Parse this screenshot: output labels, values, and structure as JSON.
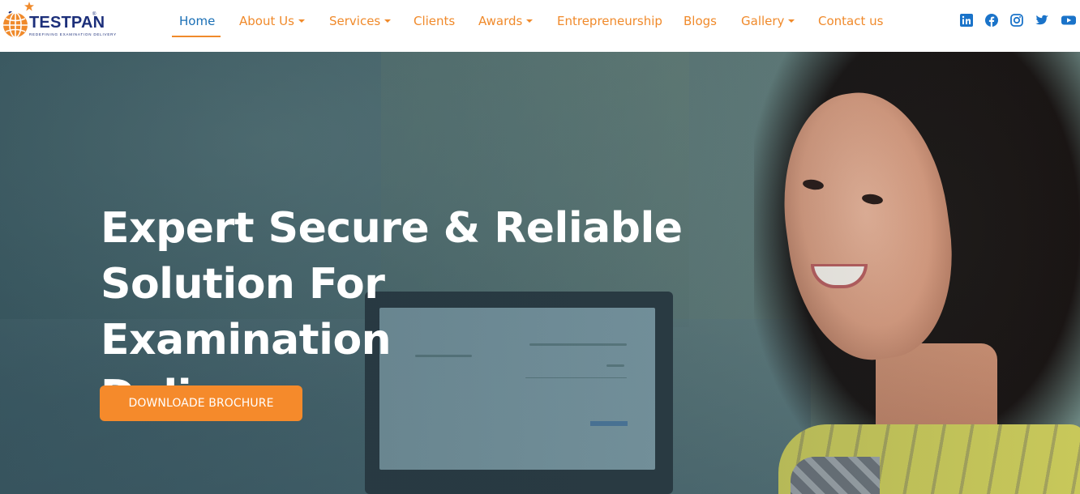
{
  "brand": {
    "name": "TESTPAN",
    "registered": "®",
    "tagline": "REDEFINING EXAMINATION DELIVERY",
    "colors": {
      "primary": "#1c2f7a",
      "accent": "#f08a2b",
      "active": "#1a6fb5"
    }
  },
  "nav": {
    "items": [
      {
        "label": "Home",
        "active": true,
        "dropdown": false
      },
      {
        "label": "About Us",
        "active": false,
        "dropdown": true
      },
      {
        "label": "Services",
        "active": false,
        "dropdown": true
      },
      {
        "label": "Clients",
        "active": false,
        "dropdown": false
      },
      {
        "label": "Awards",
        "active": false,
        "dropdown": true
      },
      {
        "label": "Entrepreneurship",
        "active": false,
        "dropdown": false
      },
      {
        "label": "Blogs",
        "active": false,
        "dropdown": false
      },
      {
        "label": "Gallery",
        "active": false,
        "dropdown": true
      },
      {
        "label": "Contact us",
        "active": false,
        "dropdown": false
      }
    ]
  },
  "social": {
    "icons": [
      "linkedin-icon",
      "facebook-icon",
      "instagram-icon",
      "twitter-icon",
      "youtube-icon"
    ],
    "color": "#1a73c9"
  },
  "hero": {
    "title_line1": "Expert Secure & Reliable",
    "title_line2": "Solution For Examination",
    "title_line3": "Delivery",
    "button_label": "DOWNLOADE BROCHURE",
    "button_color": "#f58a2b"
  }
}
